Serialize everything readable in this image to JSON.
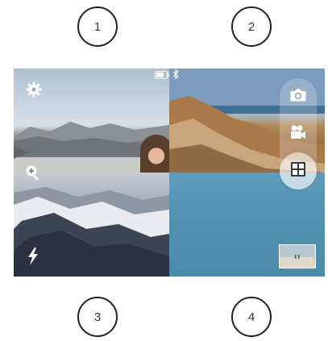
{
  "steps": [
    "1",
    "2",
    "3",
    "4"
  ],
  "icons": {
    "settings": "gear-icon",
    "zoom": "zoom-in-icon",
    "flash": "flash-icon",
    "battery": "battery-icon",
    "bluetooth": "bluetooth-icon",
    "camera": "camera-icon",
    "video": "video-camera-icon",
    "grid": "grid-icon"
  },
  "modes": [
    {
      "name": "photo",
      "active": false
    },
    {
      "name": "video",
      "active": false
    },
    {
      "name": "grid",
      "active": true
    }
  ],
  "colors": {
    "overlay": "#ffffff",
    "step_border": "#222222"
  }
}
